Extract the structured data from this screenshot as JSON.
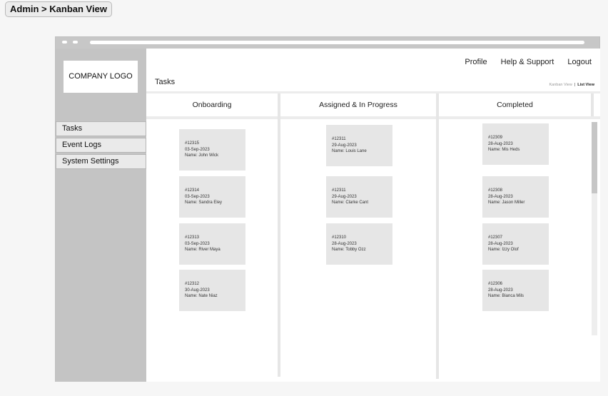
{
  "breadcrumb": "Admin > Kanban View",
  "sidebar": {
    "logo": "COMPANY LOGO",
    "items": [
      "Tasks",
      "Event Logs",
      "System Settings"
    ]
  },
  "header": {
    "nav": [
      "Profile",
      "Help & Support",
      "Logout"
    ],
    "title": "Tasks",
    "views": {
      "kanban": "Kanban View",
      "separator": "|",
      "list": "List View"
    }
  },
  "columns": [
    {
      "title": "Onboarding",
      "cards": [
        {
          "id": "#12315",
          "date": "03-Sep-2023",
          "name": "Name: John Wick"
        },
        {
          "id": "#12314",
          "date": "03-Sep-2023",
          "name": "Name: Sandra Eley"
        },
        {
          "id": "#12313",
          "date": "03-Sep-2023",
          "name": "Name: River Maya"
        },
        {
          "id": "#12312",
          "date": "30-Aug-2023",
          "name": "Name: Nate Niaz"
        }
      ]
    },
    {
      "title": "Assigned & In Progress",
      "cards": [
        {
          "id": "#12311",
          "date": "29-Aug-2023",
          "name": "Name: Louis Lane"
        },
        {
          "id": "#12311",
          "date": "29-Aug-2023",
          "name": "Name: Clarke Cant"
        },
        {
          "id": "#12310",
          "date": "28-Aug-2023",
          "name": "Name: Tobby Ozz"
        }
      ]
    },
    {
      "title": "Completed",
      "cards": [
        {
          "id": "#12309",
          "date": "28-Aug-2023",
          "name": "Name: Mis Heds"
        },
        {
          "id": "#12308",
          "date": "28-Aug-2023",
          "name": "Name: Jason Miller"
        },
        {
          "id": "#12307",
          "date": "28-Aug-2023",
          "name": "Name:  Izzy Olof"
        },
        {
          "id": "#12306",
          "date": "28-Aug-2023",
          "name": "Name: Bianca Mils"
        }
      ]
    }
  ]
}
